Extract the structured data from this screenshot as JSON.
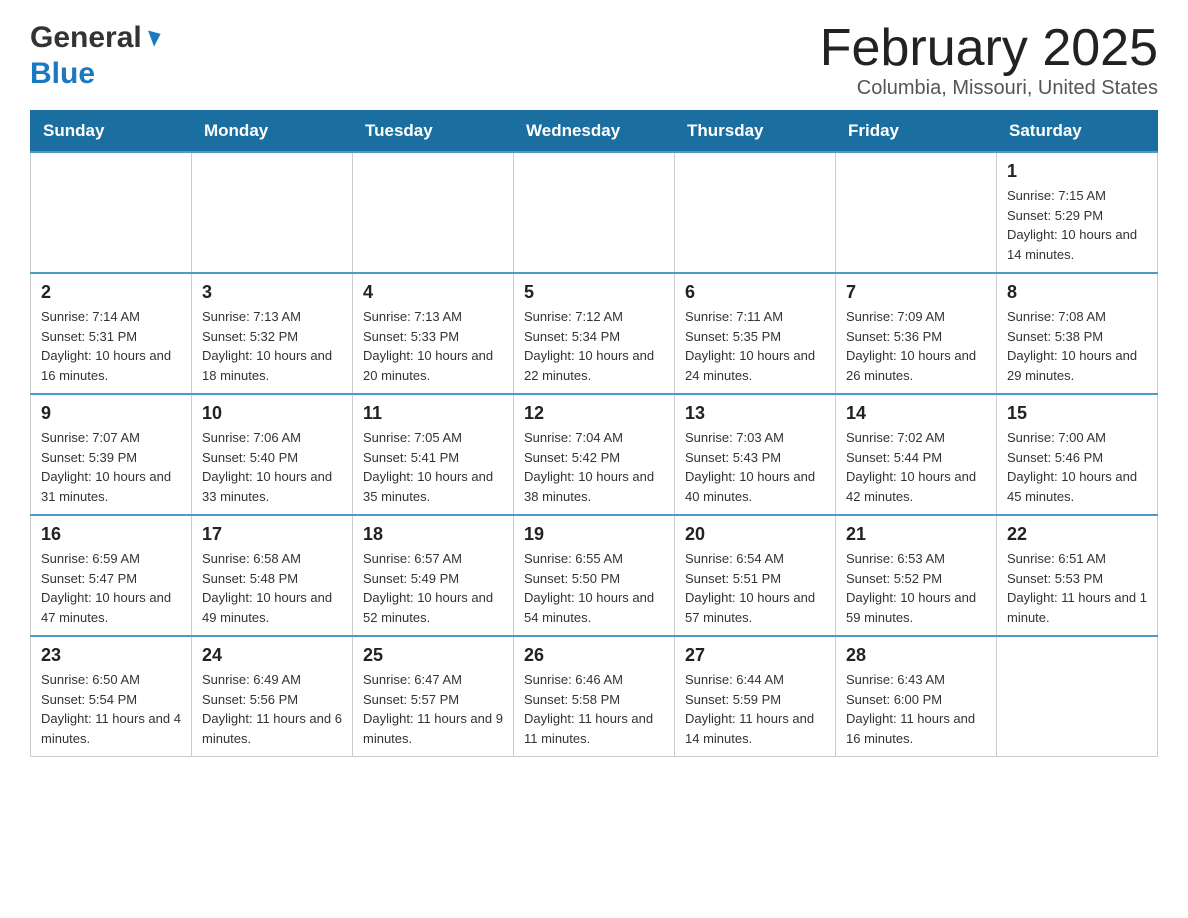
{
  "header": {
    "logo_general": "General",
    "logo_blue": "Blue",
    "month_title": "February 2025",
    "location": "Columbia, Missouri, United States"
  },
  "weekdays": [
    "Sunday",
    "Monday",
    "Tuesday",
    "Wednesday",
    "Thursday",
    "Friday",
    "Saturday"
  ],
  "weeks": [
    [
      {
        "day": "",
        "sunrise": "",
        "sunset": "",
        "daylight": ""
      },
      {
        "day": "",
        "sunrise": "",
        "sunset": "",
        "daylight": ""
      },
      {
        "day": "",
        "sunrise": "",
        "sunset": "",
        "daylight": ""
      },
      {
        "day": "",
        "sunrise": "",
        "sunset": "",
        "daylight": ""
      },
      {
        "day": "",
        "sunrise": "",
        "sunset": "",
        "daylight": ""
      },
      {
        "day": "",
        "sunrise": "",
        "sunset": "",
        "daylight": ""
      },
      {
        "day": "1",
        "sunrise": "Sunrise: 7:15 AM",
        "sunset": "Sunset: 5:29 PM",
        "daylight": "Daylight: 10 hours and 14 minutes."
      }
    ],
    [
      {
        "day": "2",
        "sunrise": "Sunrise: 7:14 AM",
        "sunset": "Sunset: 5:31 PM",
        "daylight": "Daylight: 10 hours and 16 minutes."
      },
      {
        "day": "3",
        "sunrise": "Sunrise: 7:13 AM",
        "sunset": "Sunset: 5:32 PM",
        "daylight": "Daylight: 10 hours and 18 minutes."
      },
      {
        "day": "4",
        "sunrise": "Sunrise: 7:13 AM",
        "sunset": "Sunset: 5:33 PM",
        "daylight": "Daylight: 10 hours and 20 minutes."
      },
      {
        "day": "5",
        "sunrise": "Sunrise: 7:12 AM",
        "sunset": "Sunset: 5:34 PM",
        "daylight": "Daylight: 10 hours and 22 minutes."
      },
      {
        "day": "6",
        "sunrise": "Sunrise: 7:11 AM",
        "sunset": "Sunset: 5:35 PM",
        "daylight": "Daylight: 10 hours and 24 minutes."
      },
      {
        "day": "7",
        "sunrise": "Sunrise: 7:09 AM",
        "sunset": "Sunset: 5:36 PM",
        "daylight": "Daylight: 10 hours and 26 minutes."
      },
      {
        "day": "8",
        "sunrise": "Sunrise: 7:08 AM",
        "sunset": "Sunset: 5:38 PM",
        "daylight": "Daylight: 10 hours and 29 minutes."
      }
    ],
    [
      {
        "day": "9",
        "sunrise": "Sunrise: 7:07 AM",
        "sunset": "Sunset: 5:39 PM",
        "daylight": "Daylight: 10 hours and 31 minutes."
      },
      {
        "day": "10",
        "sunrise": "Sunrise: 7:06 AM",
        "sunset": "Sunset: 5:40 PM",
        "daylight": "Daylight: 10 hours and 33 minutes."
      },
      {
        "day": "11",
        "sunrise": "Sunrise: 7:05 AM",
        "sunset": "Sunset: 5:41 PM",
        "daylight": "Daylight: 10 hours and 35 minutes."
      },
      {
        "day": "12",
        "sunrise": "Sunrise: 7:04 AM",
        "sunset": "Sunset: 5:42 PM",
        "daylight": "Daylight: 10 hours and 38 minutes."
      },
      {
        "day": "13",
        "sunrise": "Sunrise: 7:03 AM",
        "sunset": "Sunset: 5:43 PM",
        "daylight": "Daylight: 10 hours and 40 minutes."
      },
      {
        "day": "14",
        "sunrise": "Sunrise: 7:02 AM",
        "sunset": "Sunset: 5:44 PM",
        "daylight": "Daylight: 10 hours and 42 minutes."
      },
      {
        "day": "15",
        "sunrise": "Sunrise: 7:00 AM",
        "sunset": "Sunset: 5:46 PM",
        "daylight": "Daylight: 10 hours and 45 minutes."
      }
    ],
    [
      {
        "day": "16",
        "sunrise": "Sunrise: 6:59 AM",
        "sunset": "Sunset: 5:47 PM",
        "daylight": "Daylight: 10 hours and 47 minutes."
      },
      {
        "day": "17",
        "sunrise": "Sunrise: 6:58 AM",
        "sunset": "Sunset: 5:48 PM",
        "daylight": "Daylight: 10 hours and 49 minutes."
      },
      {
        "day": "18",
        "sunrise": "Sunrise: 6:57 AM",
        "sunset": "Sunset: 5:49 PM",
        "daylight": "Daylight: 10 hours and 52 minutes."
      },
      {
        "day": "19",
        "sunrise": "Sunrise: 6:55 AM",
        "sunset": "Sunset: 5:50 PM",
        "daylight": "Daylight: 10 hours and 54 minutes."
      },
      {
        "day": "20",
        "sunrise": "Sunrise: 6:54 AM",
        "sunset": "Sunset: 5:51 PM",
        "daylight": "Daylight: 10 hours and 57 minutes."
      },
      {
        "day": "21",
        "sunrise": "Sunrise: 6:53 AM",
        "sunset": "Sunset: 5:52 PM",
        "daylight": "Daylight: 10 hours and 59 minutes."
      },
      {
        "day": "22",
        "sunrise": "Sunrise: 6:51 AM",
        "sunset": "Sunset: 5:53 PM",
        "daylight": "Daylight: 11 hours and 1 minute."
      }
    ],
    [
      {
        "day": "23",
        "sunrise": "Sunrise: 6:50 AM",
        "sunset": "Sunset: 5:54 PM",
        "daylight": "Daylight: 11 hours and 4 minutes."
      },
      {
        "day": "24",
        "sunrise": "Sunrise: 6:49 AM",
        "sunset": "Sunset: 5:56 PM",
        "daylight": "Daylight: 11 hours and 6 minutes."
      },
      {
        "day": "25",
        "sunrise": "Sunrise: 6:47 AM",
        "sunset": "Sunset: 5:57 PM",
        "daylight": "Daylight: 11 hours and 9 minutes."
      },
      {
        "day": "26",
        "sunrise": "Sunrise: 6:46 AM",
        "sunset": "Sunset: 5:58 PM",
        "daylight": "Daylight: 11 hours and 11 minutes."
      },
      {
        "day": "27",
        "sunrise": "Sunrise: 6:44 AM",
        "sunset": "Sunset: 5:59 PM",
        "daylight": "Daylight: 11 hours and 14 minutes."
      },
      {
        "day": "28",
        "sunrise": "Sunrise: 6:43 AM",
        "sunset": "Sunset: 6:00 PM",
        "daylight": "Daylight: 11 hours and 16 minutes."
      },
      {
        "day": "",
        "sunrise": "",
        "sunset": "",
        "daylight": ""
      }
    ]
  ]
}
